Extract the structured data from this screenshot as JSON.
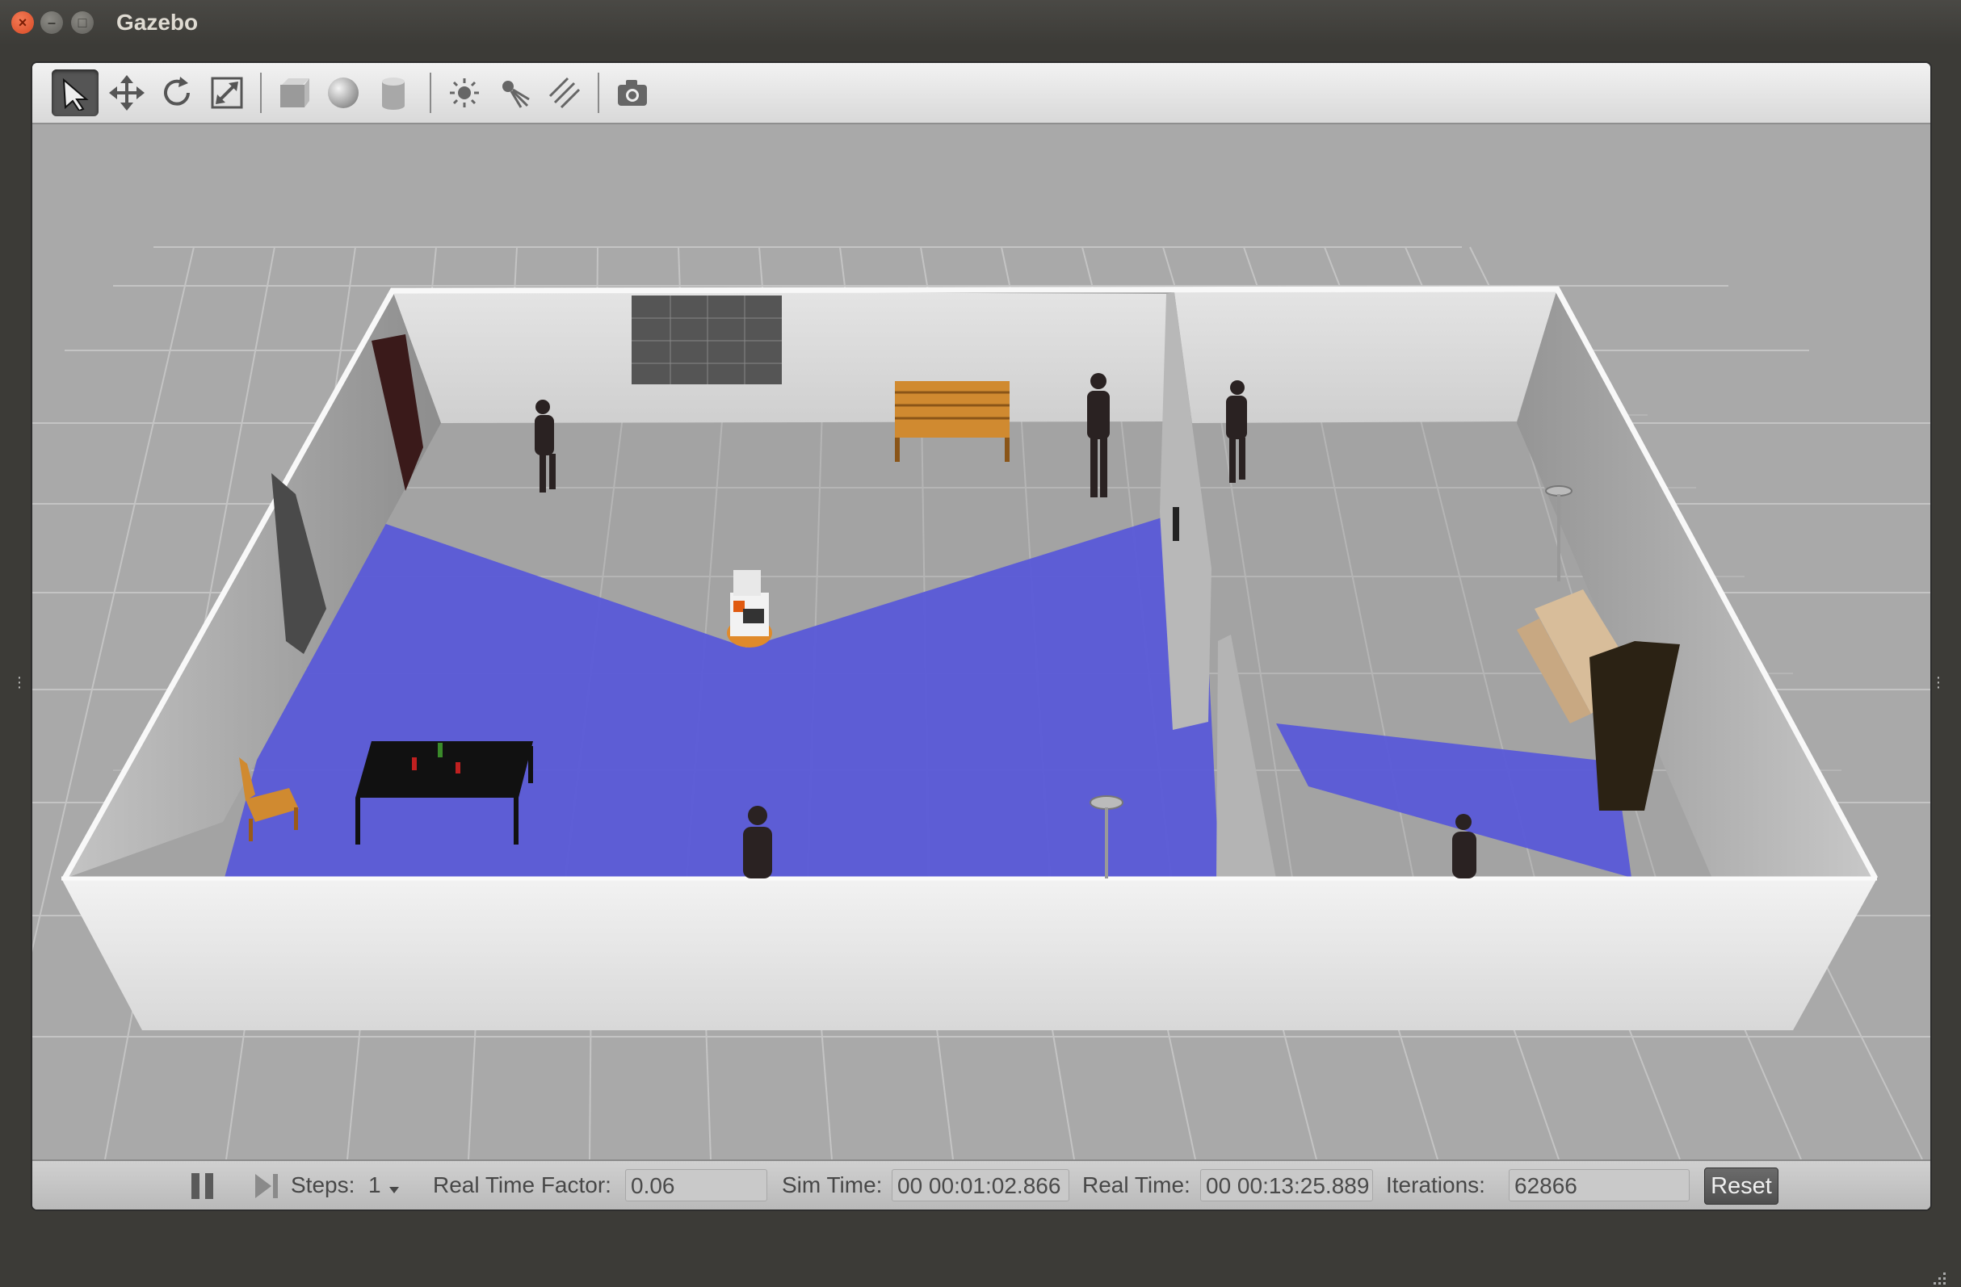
{
  "window": {
    "title": "Gazebo",
    "controls": [
      "close-icon",
      "minimize-icon",
      "maximize-icon"
    ]
  },
  "toolbar": {
    "tools": [
      {
        "name": "select-mode",
        "icon": "arrow-pointer-icon",
        "active": true
      },
      {
        "name": "translate-mode",
        "icon": "move-arrows-icon"
      },
      {
        "name": "rotate-mode",
        "icon": "rotate-icon"
      },
      {
        "name": "scale-mode",
        "icon": "scale-icon"
      },
      {
        "name": "box-shape",
        "icon": "box-icon"
      },
      {
        "name": "sphere-shape",
        "icon": "sphere-icon"
      },
      {
        "name": "cylinder-shape",
        "icon": "cylinder-icon"
      },
      {
        "name": "point-light",
        "icon": "point-light-icon"
      },
      {
        "name": "spot-light",
        "icon": "spot-light-icon"
      },
      {
        "name": "directional-light",
        "icon": "directional-light-icon"
      },
      {
        "name": "screenshot",
        "icon": "camera-icon"
      }
    ]
  },
  "scene": {
    "description_colors": {
      "ground": "#a9a9a9",
      "wall": "#e8e8e8",
      "laser": "#5a5ad8"
    }
  },
  "bottom_bar": {
    "steps_label": "Steps:",
    "steps_value": "1",
    "rtf_label": "Real Time Factor:",
    "rtf_value": "0.06",
    "sim_time_label": "Sim Time:",
    "sim_time_value": "00 00:01:02.866",
    "real_time_label": "Real Time:",
    "real_time_value": "00 00:13:25.889",
    "iterations_label": "Iterations:",
    "iterations_value": "62866",
    "reset_label": "Reset"
  }
}
